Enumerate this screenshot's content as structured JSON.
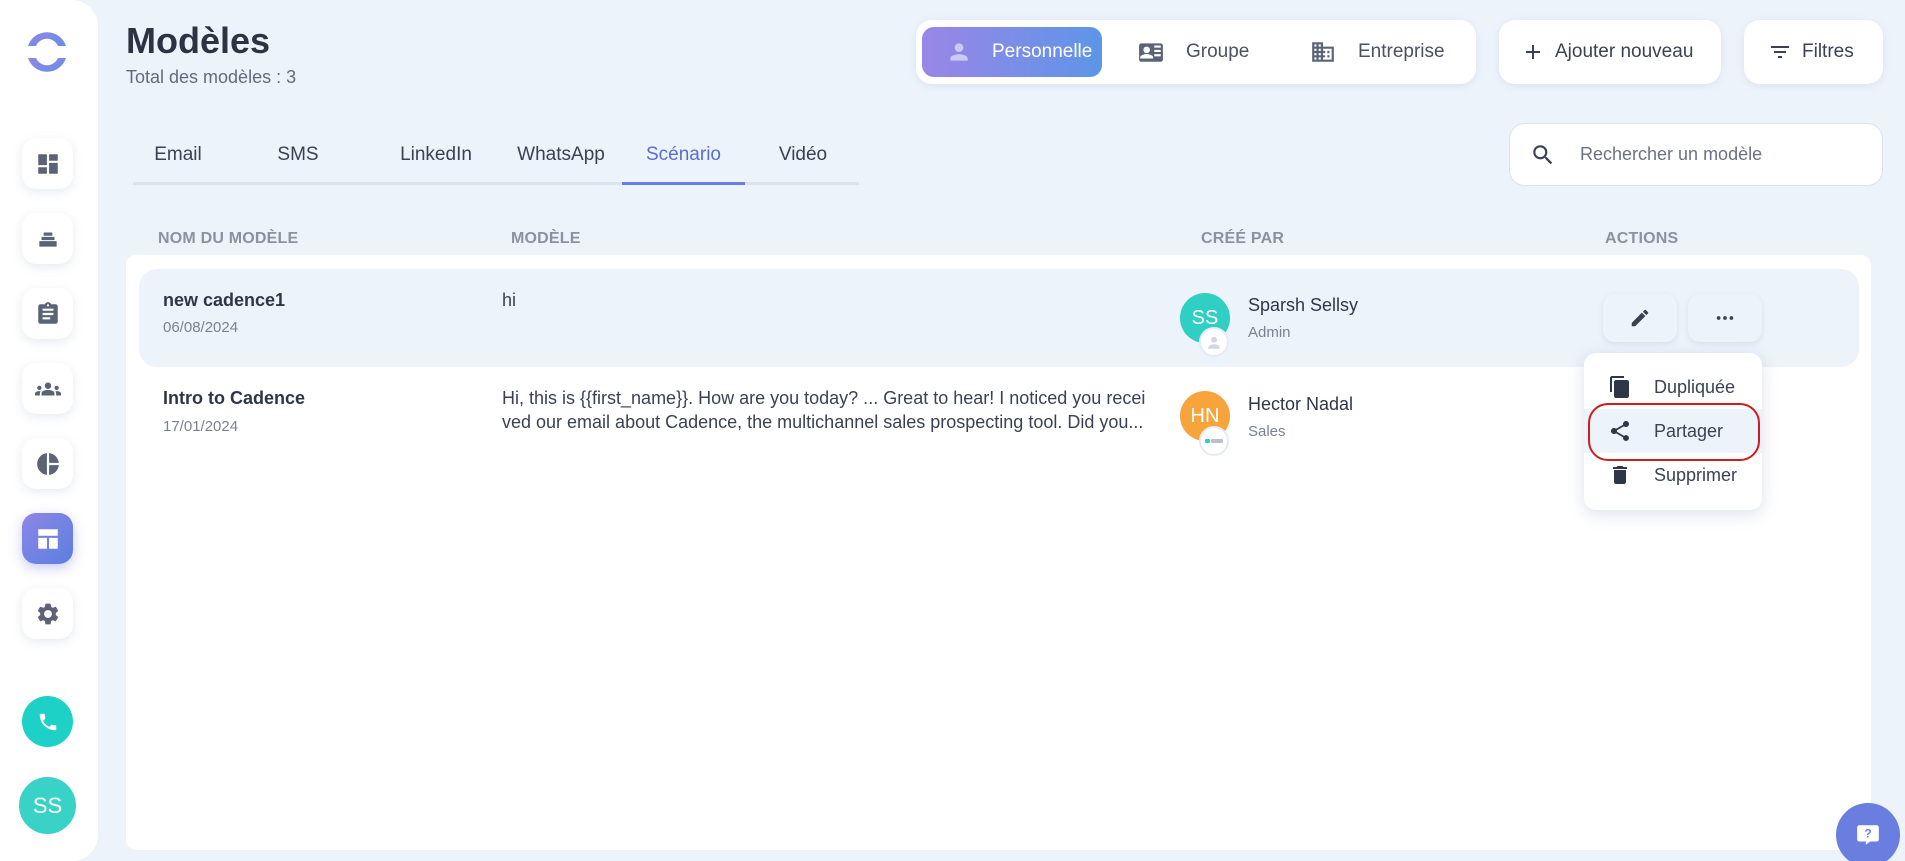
{
  "header": {
    "title": "Modèles",
    "subtitle": "Total des modèles : 3"
  },
  "scope": {
    "items": [
      {
        "label": "Personnelle",
        "icon": "person-icon",
        "active": true
      },
      {
        "label": "Groupe",
        "icon": "contact-card-icon",
        "active": false
      },
      {
        "label": "Entreprise",
        "icon": "building-icon",
        "active": false
      }
    ]
  },
  "toolbar": {
    "add_label": "Ajouter nouveau",
    "filters_label": "Filtres"
  },
  "tabs": [
    {
      "label": "Email"
    },
    {
      "label": "SMS"
    },
    {
      "label": "LinkedIn"
    },
    {
      "label": "WhatsApp"
    },
    {
      "label": "Scénario",
      "active": true
    },
    {
      "label": "Vidéo"
    }
  ],
  "search": {
    "placeholder": "Rechercher un modèle"
  },
  "table": {
    "columns": [
      "NOM DU MODÈLE",
      "MODÈLE",
      "CRÉÉ PAR",
      "ACTIONS"
    ],
    "rows": [
      {
        "name": "new cadence1",
        "date": "06/08/2024",
        "model": "hi",
        "creator_initials": "SS",
        "creator_name": "Sparsh Sellsy",
        "creator_role": "Admin"
      },
      {
        "name": "Intro to Cadence",
        "date": "17/01/2024",
        "model_line1": "Hi, this is {{first_name}}. How are you today? ... Great to hear! I noticed you recei",
        "model_line2": "ved our email about Cadence, the multichannel sales prospecting tool. Did you...",
        "creator_initials": "HN",
        "creator_name": "Hector Nadal",
        "creator_role": "Sales"
      }
    ]
  },
  "menu": {
    "items": [
      {
        "label": "Dupliquée",
        "icon": "copy-icon"
      },
      {
        "label": "Partager",
        "icon": "share-icon"
      },
      {
        "label": "Supprimer",
        "icon": "trash-icon"
      }
    ]
  },
  "user": {
    "initials": "SS"
  },
  "colors": {
    "accent": "#6a7ee0",
    "teal": "#1ed1c6",
    "focus_ring": "#d21c1c"
  }
}
